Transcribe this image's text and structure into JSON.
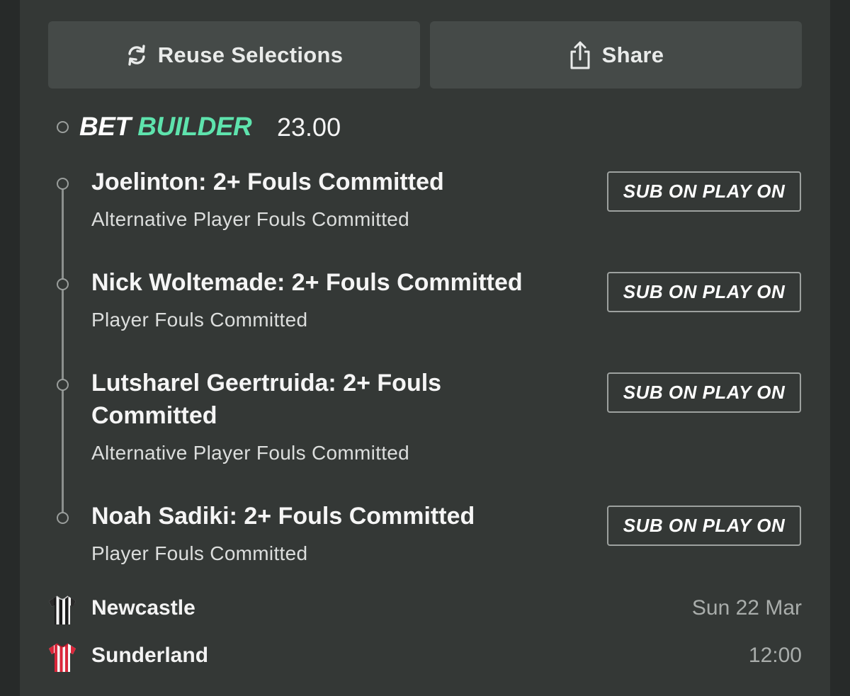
{
  "actions": {
    "reuse_label": "Reuse Selections",
    "share_label": "Share"
  },
  "bet_builder": {
    "title_part1": "BET",
    "title_part2": "BUILDER",
    "odds": "23.00",
    "accent_color": "#5ee3ad"
  },
  "legs": [
    {
      "title": "Joelinton: 2+ Fouls Committed",
      "market": "Alternative Player Fouls Committed",
      "tag": "SUB ON PLAY ON"
    },
    {
      "title": "Nick Woltemade: 2+ Fouls Committed",
      "market": "Player Fouls Committed",
      "tag": "SUB ON PLAY ON"
    },
    {
      "title": "Lutsharel Geertruida: 2+ Fouls Committed",
      "market": "Alternative Player Fouls Committed",
      "tag": "SUB ON PLAY ON"
    },
    {
      "title": "Noah Sadiki: 2+ Fouls Committed",
      "market": "Player Fouls Committed",
      "tag": "SUB ON PLAY ON"
    }
  ],
  "match": {
    "home": {
      "name": "Newcastle",
      "icon": "striped-shirt-black-white-icon"
    },
    "away": {
      "name": "Sunderland",
      "icon": "striped-shirt-red-white-icon"
    },
    "date": "Sun 22 Mar",
    "time": "12:00"
  }
}
